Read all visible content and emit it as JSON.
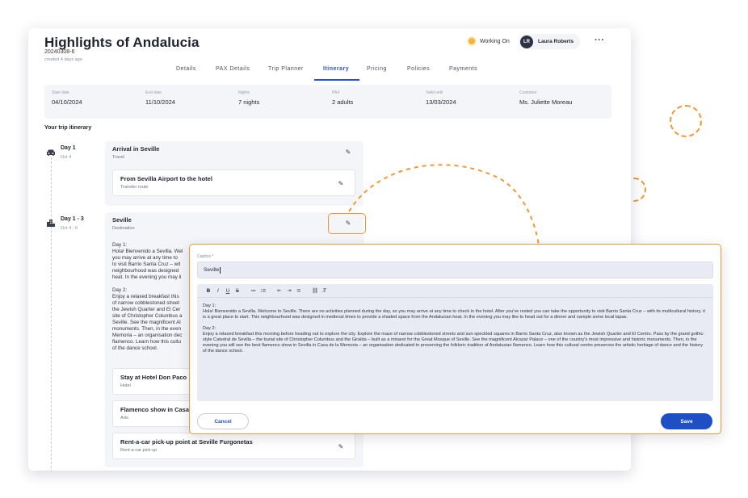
{
  "trip": {
    "title": "Highlights of Andalucia",
    "ref": "20240308-6",
    "created": "created 4 days ago"
  },
  "header": {
    "status_label": "Working On",
    "user_initials": "LR",
    "user_name": "Laura Roberts",
    "more_label": "···"
  },
  "tabs": [
    {
      "label": "Details"
    },
    {
      "label": "PAX Details"
    },
    {
      "label": "Trip Planner"
    },
    {
      "label": "Itinerary"
    },
    {
      "label": "Pricing"
    },
    {
      "label": "Policies"
    },
    {
      "label": "Payments"
    }
  ],
  "active_tab": "Itinerary",
  "summary": [
    {
      "label": "Start date",
      "value": "04/10/2024"
    },
    {
      "label": "End date",
      "value": "11/10/2024"
    },
    {
      "label": "Nights",
      "value": "7 nights"
    },
    {
      "label": "PAX",
      "value": "2 adults"
    },
    {
      "label": "Valid until",
      "value": "13/03/2024"
    },
    {
      "label": "Customer",
      "value": "Ms. Juliette Moreau"
    }
  ],
  "itinerary_title": "Your trip itinerary",
  "days": [
    {
      "title": "Day 1",
      "sub": "Oct 4",
      "icon": "car-icon",
      "header": {
        "title": "Arrival in Seville",
        "sub": "Travel"
      },
      "items": [
        {
          "title": "From Sevilla Airport to the hotel",
          "sub": "Transfer route"
        }
      ]
    },
    {
      "title": "Day 1 - 3",
      "sub": "Oct 4 - 6",
      "icon": "city-icon",
      "header": {
        "title": "Seville",
        "sub": "Destination"
      },
      "desc": [
        "Day 1:",
        "Hola! Bienvenido a Sevilla. Wel",
        "you may arrive at any time to",
        "to visit Barrio Santa Cruz – wit",
        "neighbourhood was designed",
        "heat. In the evening you may li",
        "",
        "Day 2:",
        "Enjoy a relaxed breakfast this",
        "of narrow cobblestoned street",
        "the Jewish Quarter and El Cer",
        "site of Christopher Columbus a",
        "Seville. See the magnificent Al",
        "monuments. Then, in the even",
        "Memoria – an organisation dec",
        "flamenco. Learn how this cultu",
        "of the dance school."
      ],
      "items": [
        {
          "title": "Stay at Hotel Don Paco",
          "sub": "Hotel"
        },
        {
          "title": "Flamenco show in Casa",
          "sub": "Arts"
        },
        {
          "title": "Rent-a-car pick-up point at Seville Furgonetas",
          "sub": "Rent-a-car pick-up"
        }
      ]
    }
  ],
  "modal": {
    "caption_label": "Caption *",
    "caption_value": "Seville",
    "toolbar": [
      "B",
      "I",
      "U",
      "S",
      "≔",
      "⁝≡",
      "⇤",
      "⇥",
      "≡",
      "⛓",
      "T̸"
    ],
    "body": [
      "Day 1:",
      "Hola! Bienvenido a Sevilla. Welcome to Seville. There are no activities planned during the day, so you may arrive at any time to check in the hotel. After you've rested you can take the opportunity to visit Barrio Santa Cruz – with its multicultural history, it is a great place to start. This neighbourhood was designed in medieval times to provide a shaded space from the Andalucian heat. In the evening you may like to head out for a dinner and sample some local tapas.",
      "Day 2:",
      "Enjoy a relaxed breakfast this morning before heading out to explore the city. Explore the maze of narrow cobblestoned streets and sun-speckled squares in Barrio Santa Cruz, also known as the Jewish Quarter and El Centro. Pass by the grand gothic-style Catedral de Sevilla – the burial site of Christopher Columbus and the Giralda – built as a minaret for the Great Mosque of Seville. See the magnificent Alcazar Palace – one of the country's most impressive and historic monuments. Then, in the evening you will see the best flamenco show in Sevilla in Casa de la Memoria – an organisation dedicated to preserving the folkloric tradition of Andalusian flamenco. Learn how this cultural centre preserves the artistic heritage of dance and the history of the dance school."
    ],
    "cancel_label": "Cancel",
    "save_label": "Save"
  },
  "colors": {
    "accent": "#2c52c9",
    "highlight": "#f0973a",
    "status": "#f5b43a"
  }
}
